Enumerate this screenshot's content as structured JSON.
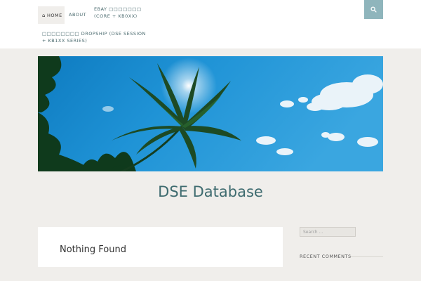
{
  "nav": {
    "home_icon": "home-icon",
    "home_label": "Home",
    "about_label": "About",
    "ebay_label": "eBay □□□□□□□ (Core + KB0xx)",
    "dropship_label": "□□□□□□□□ Dropship (DSE Session + KB1xx Series)"
  },
  "search": {
    "icon": "search-icon",
    "placeholder": "Search …"
  },
  "site": {
    "title": "DSE Database"
  },
  "main": {
    "heading": "Nothing Found"
  },
  "sidebar": {
    "recent_comments_label": "Recent Comments"
  },
  "colors": {
    "accent": "#8fb5bc",
    "title": "#3e6b6f",
    "background": "#f0eeeb"
  }
}
